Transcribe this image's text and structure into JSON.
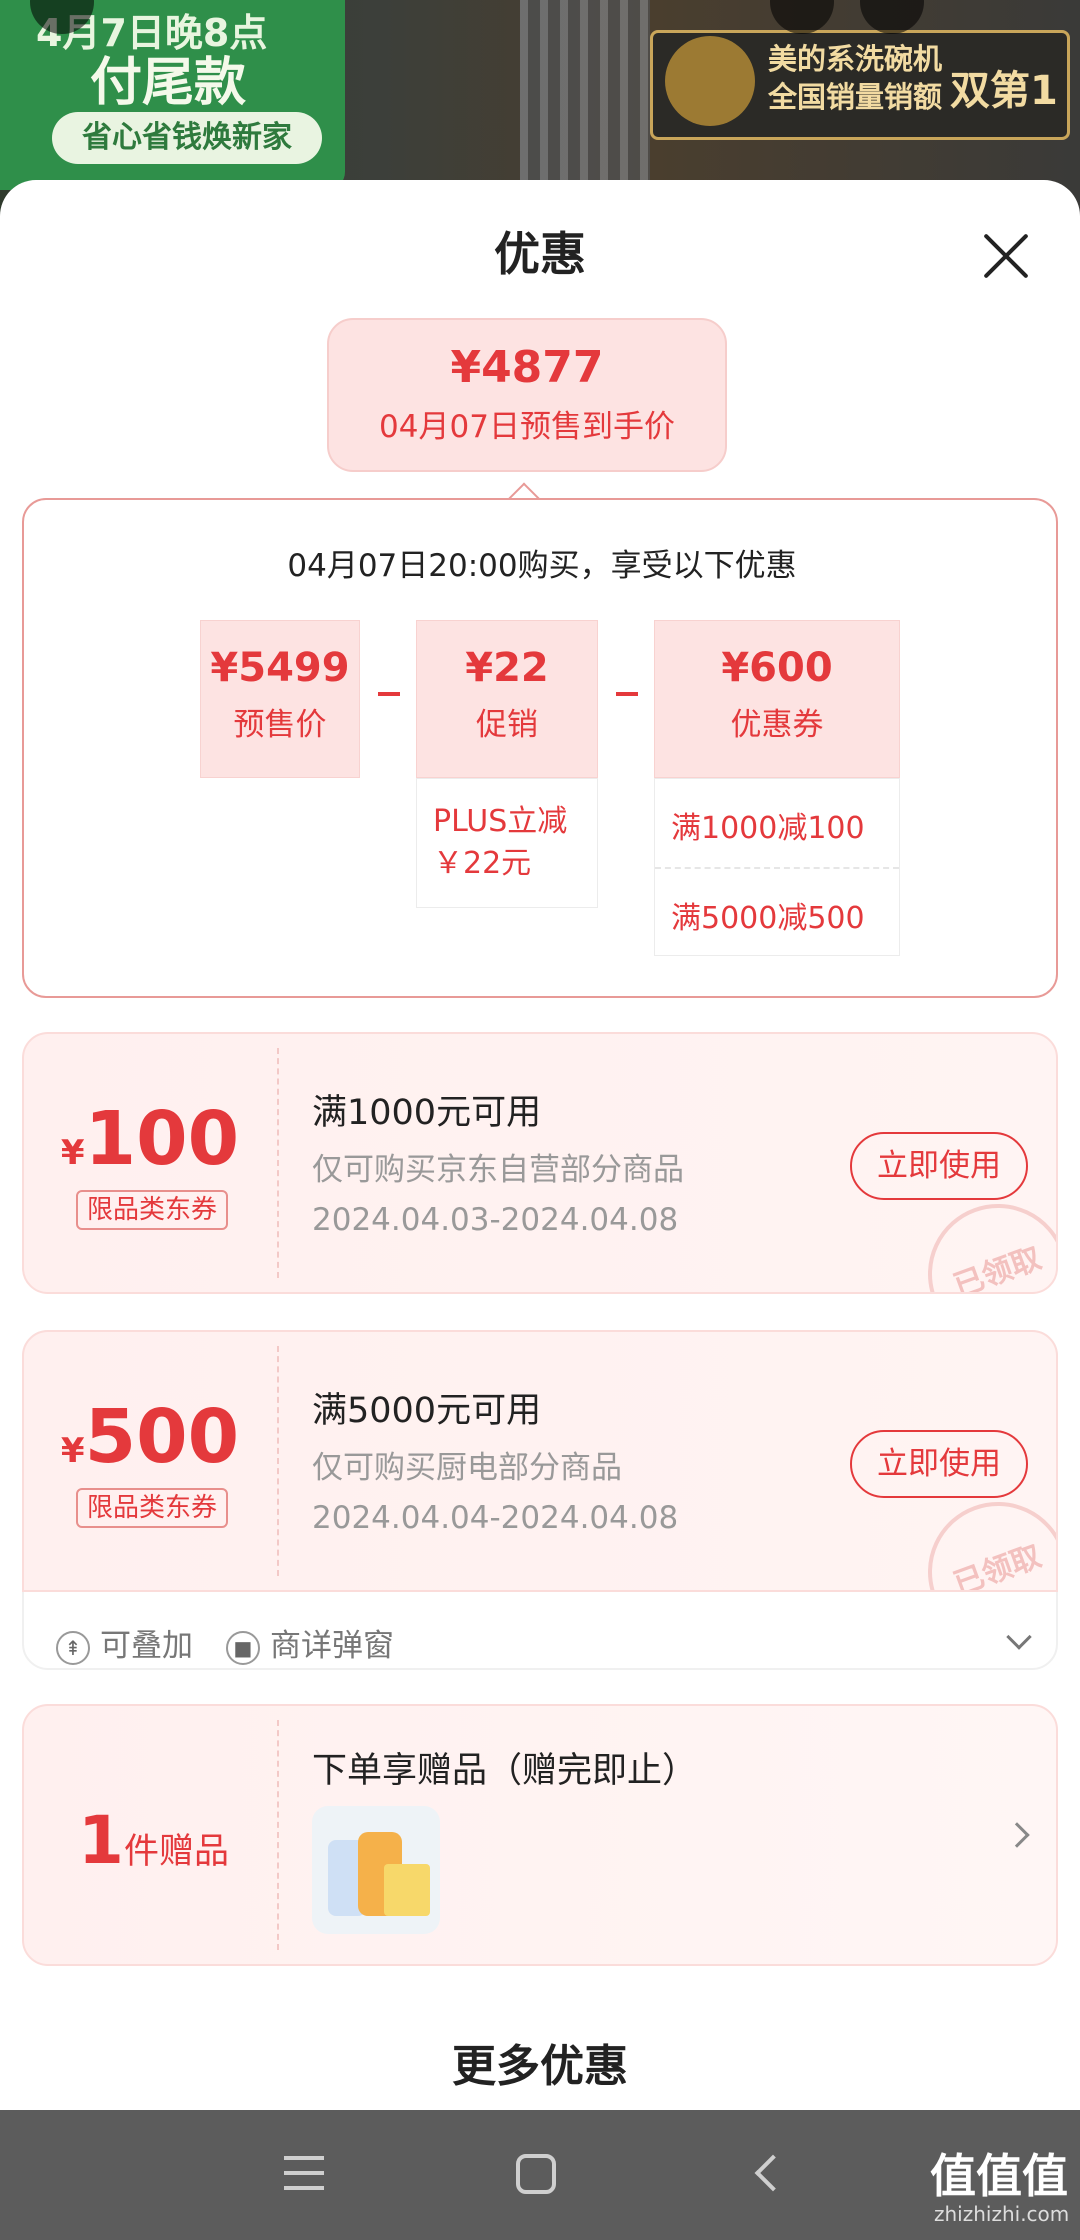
{
  "banner": {
    "line1": "4月7日晚8点",
    "line2": "付尾款",
    "pill": "省心省钱焕新家",
    "gold_title_1": "美的系洗碗机",
    "gold_title_2": "全国销量销额",
    "gold_big": "双第1"
  },
  "sheet": {
    "title": "优惠"
  },
  "final_price": {
    "amount": "¥4877",
    "label": "04月07日预售到手价"
  },
  "detail": {
    "caption": "04月07日20:00购买，享受以下优惠",
    "items": [
      {
        "amount": "¥5499",
        "label": "预售价"
      },
      {
        "amount": "¥22",
        "label": "促销"
      },
      {
        "amount": "¥600",
        "label": "优惠券"
      }
    ],
    "promo_sub": {
      "line1": "PLUS立减",
      "line2": "￥22元"
    },
    "coupon_sub": [
      "满1000减100",
      "满5000减500"
    ]
  },
  "coupons": [
    {
      "yen": "¥",
      "amount": "100",
      "tag": "限品类东券",
      "condition": "满1000元可用",
      "scope": "仅可购买京东自营部分商品",
      "date": "2024.04.03-2024.04.08",
      "button": "立即使用",
      "stamp": "已领取"
    },
    {
      "yen": "¥",
      "amount": "500",
      "tag": "限品类东券",
      "condition": "满5000元可用",
      "scope": "仅可购买厨电部分商品",
      "date": "2024.04.04-2024.04.08",
      "button": "立即使用",
      "stamp": "已领取"
    }
  ],
  "stack_row": {
    "stackable": "可叠加",
    "popup": "商详弹窗"
  },
  "gift": {
    "count": "1",
    "unit": "件赠品",
    "title": "下单享赠品（赠完即止）"
  },
  "more": "更多优惠",
  "watermark": {
    "main": "值值值",
    "sub": "zhizhizhi.com"
  }
}
